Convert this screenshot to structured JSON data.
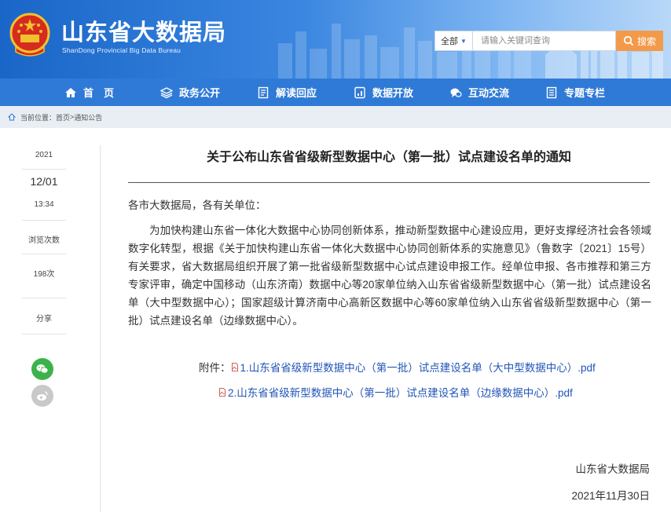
{
  "header": {
    "title": "山东省大数据局",
    "subtitle": "ShanDong Provincial Big Data Bureau",
    "search": {
      "scope": "全部",
      "placeholder": "请输入关键词查询",
      "button_label": "搜索"
    }
  },
  "nav": {
    "items": [
      {
        "label": "首　页",
        "icon": "home-icon"
      },
      {
        "label": "政务公开",
        "icon": "layers-icon"
      },
      {
        "label": "解读回应",
        "icon": "document-icon"
      },
      {
        "label": "数据开放",
        "icon": "data-icon"
      },
      {
        "label": "互动交流",
        "icon": "chat-icon"
      },
      {
        "label": "专题专栏",
        "icon": "list-icon"
      }
    ]
  },
  "breadcrumb": {
    "prefix": "当前位置：",
    "home": "首页",
    "sep": ">",
    "current": "通知公告"
  },
  "meta": {
    "year": "2021",
    "date": "12/01",
    "time": "13:34",
    "views_label": "浏览次数",
    "views": "198次",
    "share_label": "分享",
    "share_icons": [
      "wechat-icon",
      "weibo-icon"
    ]
  },
  "article": {
    "title": "关于公布山东省省级新型数据中心（第一批）试点建设名单的通知",
    "salutation": "各市大数据局，各有关单位：",
    "body": "为加快构建山东省一体化大数据中心协同创新体系，推动新型数据中心建设应用，更好支撑经济社会各领域数字化转型，根据《关于加快构建山东省一体化大数据中心协同创新体系的实施意见》（鲁数字〔2021〕15号）有关要求，省大数据局组织开展了第一批省级新型数据中心试点建设申报工作。经单位申报、各市推荐和第三方专家评审，确定中国移动（山东济南）数据中心等20家单位纳入山东省省级新型数据中心（第一批）试点建设名单（大中型数据中心）；国家超级计算济南中心高新区数据中心等60家单位纳入山东省省级新型数据中心（第一批）试点建设名单（边缘数据中心）。",
    "attachments_label": "附件：",
    "attachments": [
      "1.山东省省级新型数据中心（第一批）试点建设名单（大中型数据中心）.pdf",
      "2.山东省省级新型数据中心（第一批）试点建设名单（边缘数据中心）.pdf"
    ],
    "signature": "山东省大数据局",
    "sign_date": "2021年11月30日"
  },
  "colors": {
    "nav_bg": "#2f7ad6",
    "search_button": "#f39a4a",
    "link": "#2255b8",
    "wechat": "#3cb34a",
    "weibo_gray": "#c9c9c9"
  }
}
